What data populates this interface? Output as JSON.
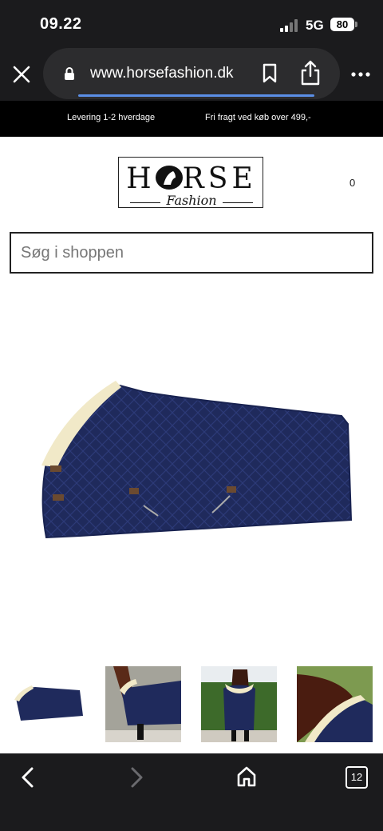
{
  "status_bar": {
    "time": "09.22",
    "network": "5G",
    "battery": "80"
  },
  "browser": {
    "url": "www.horsefashion.dk",
    "tab_count": "12"
  },
  "promo": {
    "item1": "Levering 1-2 hverdage",
    "item2": "Fri fragt ved køb over 499,-"
  },
  "logo": {
    "main_left": "H",
    "main_right": "RSE",
    "sub": "Fashion"
  },
  "cart": {
    "count": "0"
  },
  "search": {
    "placeholder": "Søg i shoppen"
  },
  "colors": {
    "rug_navy": "#1f2a5c",
    "fleece": "#f1e9c8",
    "browser_chrome": "#1b1b1d",
    "accent_progress": "#5b8fe6"
  },
  "icons": [
    "close-icon",
    "lock-icon",
    "bookmark-icon",
    "share-icon",
    "more-icon",
    "back-icon",
    "forward-icon",
    "home-icon",
    "tabs-icon"
  ]
}
